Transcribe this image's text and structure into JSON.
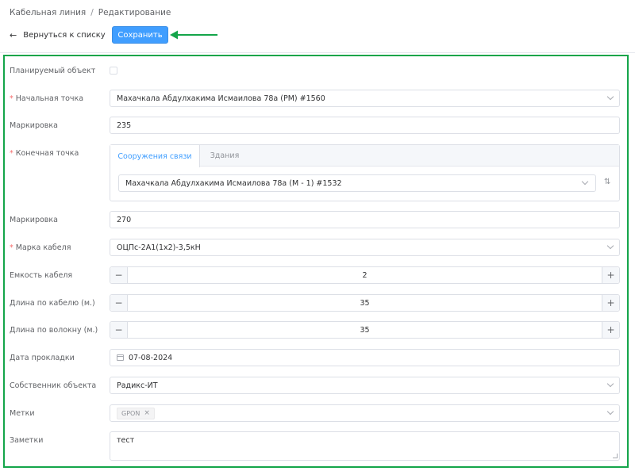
{
  "breadcrumb": {
    "parent": "Кабельная линия",
    "separator": "/",
    "current": "Редактирование"
  },
  "toolbar": {
    "back_label": "Вернуться к списку",
    "back_icon": "arrow-left-icon",
    "save_label": "Сохранить"
  },
  "colors": {
    "accent": "#409eff",
    "required": "#f56c6c",
    "annotation": "#14a54a"
  },
  "form": {
    "planned": {
      "label": "Планируемый объект",
      "checked": false
    },
    "start_point": {
      "label": "Начальная точка",
      "required": true,
      "value": "Махачкала Абдулхакима Исмаилова 78а (РМ) #1560"
    },
    "marking1": {
      "label": "Маркировка",
      "value": "235"
    },
    "end_point": {
      "label": "Конечная точка",
      "required": true,
      "tabs": [
        "Сооружения связи",
        "Здания"
      ],
      "active_tab": "Сооружения связи",
      "value": "Махачкала Абдулхакима Исмаилова 78а (М - 1) #1532"
    },
    "marking2": {
      "label": "Маркировка",
      "value": "270"
    },
    "cable_brand": {
      "label": "Марка кабеля",
      "required": true,
      "value": "ОЦПс-2А1(1х2)-3,5кН"
    },
    "cable_capacity": {
      "label": "Емкость кабеля",
      "value": "2"
    },
    "cable_length": {
      "label": "Длина по кабелю (м.)",
      "value": "35"
    },
    "fiber_length": {
      "label": "Длина по волокну (м.)",
      "value": "35"
    },
    "laying_date": {
      "label": "Дата прокладки",
      "value": "07-08-2024"
    },
    "owner": {
      "label": "Собственник объекта",
      "value": "Радикс-ИТ"
    },
    "tags": {
      "label": "Метки",
      "items": [
        "GPON"
      ]
    },
    "notes": {
      "label": "Заметки",
      "value": "тест"
    }
  }
}
